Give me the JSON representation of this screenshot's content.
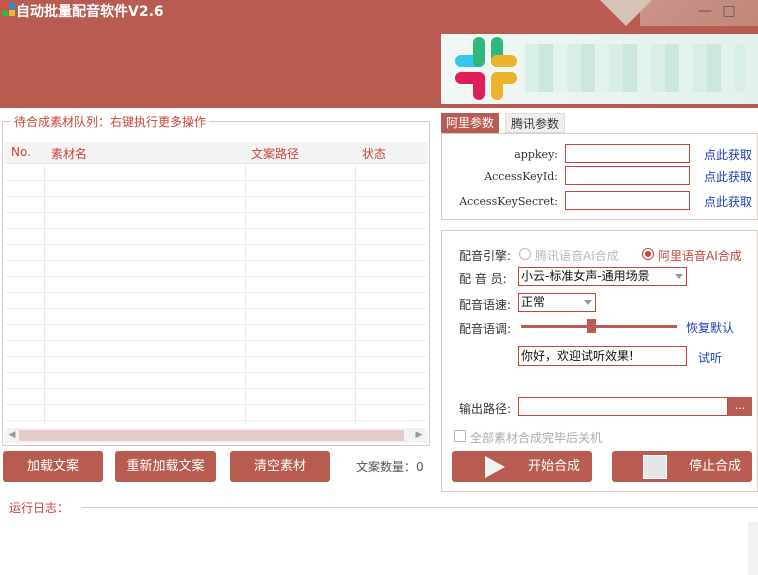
{
  "window": {
    "title": "自动批量配音软件V2.6",
    "minimize_icon": "minimize-icon",
    "maximize_icon": "maximize-icon",
    "colors": {
      "accent": "#b85c52",
      "accent_text": "#c9453c",
      "link": "#1a3cbf"
    }
  },
  "queue": {
    "legend": "待合成素材队列：右键执行更多操作",
    "columns": [
      "No.",
      "素材名",
      "文案路径",
      "状态"
    ],
    "rows": []
  },
  "left_buttons": {
    "load": "加载文案",
    "reload": "重新加载文案",
    "clear": "清空素材",
    "count_label": "文案数量：0"
  },
  "tabs": [
    {
      "label": "阿里参数",
      "active": true
    },
    {
      "label": "腾讯参数",
      "active": false
    }
  ],
  "ali_params": {
    "appkey_label": "appkey:",
    "access_key_id_label": "AccessKeyId:",
    "access_key_secret_label": "AccessKeySecret:",
    "get_link": "点此获取",
    "appkey_value": "",
    "access_key_id_value": "",
    "access_key_secret_value": ""
  },
  "voice": {
    "engine_label": "配音引擎:",
    "engine_options": [
      "腾讯语音AI合成",
      "阿里语音AI合成"
    ],
    "engine_selected": "阿里语音AI合成",
    "voice_label": "配 音 员:",
    "voice_value": "小云-标准女声-通用场景",
    "speed_label": "配音语速:",
    "speed_value": "正常",
    "pitch_label": "配音语调:",
    "pitch_level": 0.45,
    "reset_link": "恢复默认",
    "test_text": "你好，欢迎试听效果!",
    "test_link": "试听",
    "output_label": "输出路径:",
    "output_value": "",
    "browse_label": "...",
    "shutdown_label": "全部素材合成完毕后关机",
    "shutdown_checked": false,
    "start_label": "开始合成",
    "stop_label": "停止合成"
  },
  "log": {
    "label": "运行日志："
  }
}
